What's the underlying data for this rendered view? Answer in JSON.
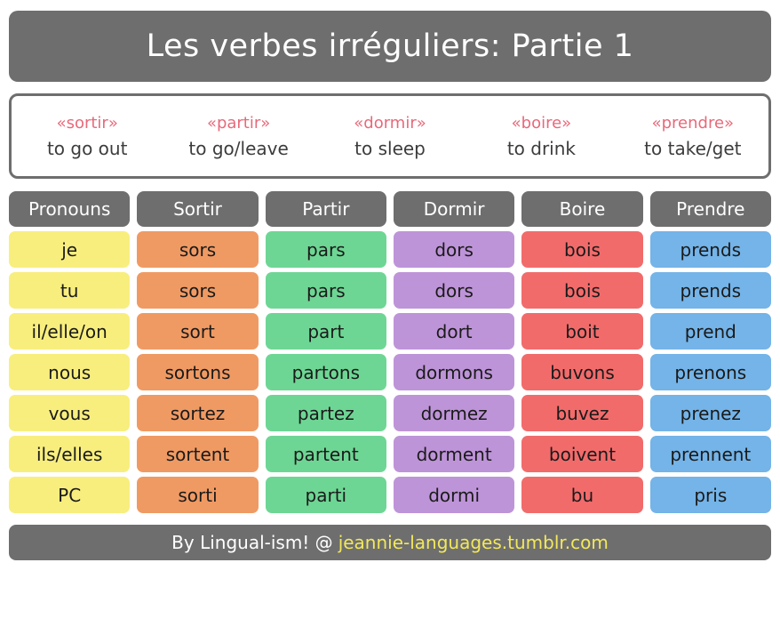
{
  "title": {
    "text": "Les verbes irréguliers: Partie 1"
  },
  "legend": {
    "items": [
      {
        "verb": "«sortir»",
        "meaning": "to go out"
      },
      {
        "verb": "«partir»",
        "meaning": "to go/leave"
      },
      {
        "verb": "«dormir»",
        "meaning": "to sleep"
      },
      {
        "verb": "«boire»",
        "meaning": "to drink"
      },
      {
        "verb": "«prendre»",
        "meaning": "to take/get"
      }
    ]
  },
  "table": {
    "headers": [
      "Pronouns",
      "Sortir",
      "Partir",
      "Dormir",
      "Boire",
      "Prendre"
    ],
    "rows": [
      [
        "je",
        "sors",
        "pars",
        "dors",
        "bois",
        "prends"
      ],
      [
        "tu",
        "sors",
        "pars",
        "dors",
        "bois",
        "prends"
      ],
      [
        "il/elle/on",
        "sort",
        "part",
        "dort",
        "boit",
        "prend"
      ],
      [
        "nous",
        "sortons",
        "partons",
        "dormons",
        "buvons",
        "prenons"
      ],
      [
        "vous",
        "sortez",
        "partez",
        "dormez",
        "buvez",
        "prenez"
      ],
      [
        "ils/elles",
        "sortent",
        "partent",
        "dorment",
        "boivent",
        "prennent"
      ],
      [
        "PC",
        "sorti",
        "parti",
        "dormi",
        "bu",
        "pris"
      ]
    ],
    "column_colors": [
      "#f8ee7e",
      "#f09a63",
      "#6ed694",
      "#be94d8",
      "#f26b6b",
      "#74b4e8"
    ],
    "header_color": "#6e6e6e"
  },
  "footer": {
    "credit": "By Lingual-ism! @",
    "url": "jeannie-languages.tumblr.com"
  },
  "colors": {
    "banner_gray": "#6e6e6e",
    "legend_red": "#e8697a",
    "footer_yellow": "#f2e85c",
    "page_background": "#ffffff"
  }
}
